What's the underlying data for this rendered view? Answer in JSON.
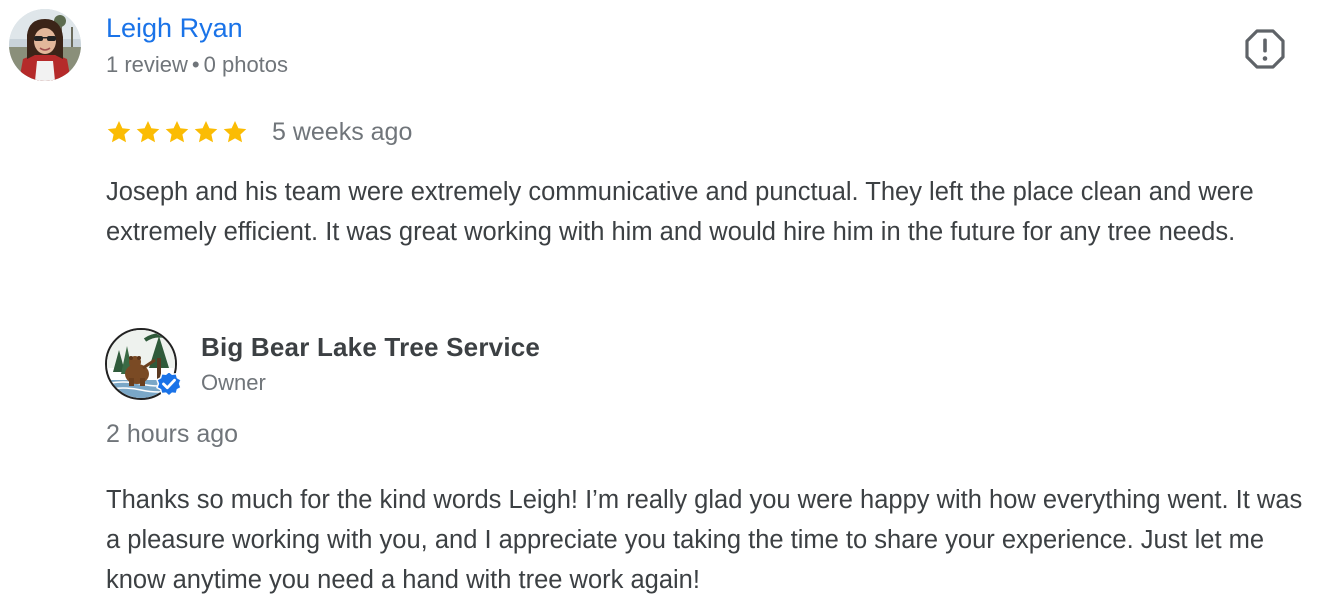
{
  "review": {
    "reviewer_name": "Leigh Ryan",
    "review_count": "1 review",
    "meta_separator": "•",
    "photo_count": "0 photos",
    "rating": 5,
    "rating_max": 5,
    "star_color": "#fbbc04",
    "date": "5 weeks ago",
    "text": "Joseph and his team were extremely communicative and punctual. They left the place clean and were extremely efficient. It was great working with him and would hire him in the future for any tree needs.",
    "avatar_icon": "reviewer-avatar-photo",
    "report_icon": "flag-report-icon"
  },
  "response": {
    "owner_name": "Big Bear Lake Tree Service",
    "role": "Owner",
    "date": "2 hours ago",
    "text": "Thanks so much for the kind words Leigh! I’m really glad you were happy with how everything went. It was a pleasure working with you, and I appreciate you taking the time to share your experience. Just let me know anytime you need a hand with tree work again!",
    "logo_icon": "bear-tree-logo",
    "verified_icon": "verified-badge-icon",
    "verified_color": "#1a73e8"
  },
  "colors": {
    "name_link": "#1a73e8",
    "text_primary": "#3c4043",
    "text_secondary": "#70757a"
  }
}
